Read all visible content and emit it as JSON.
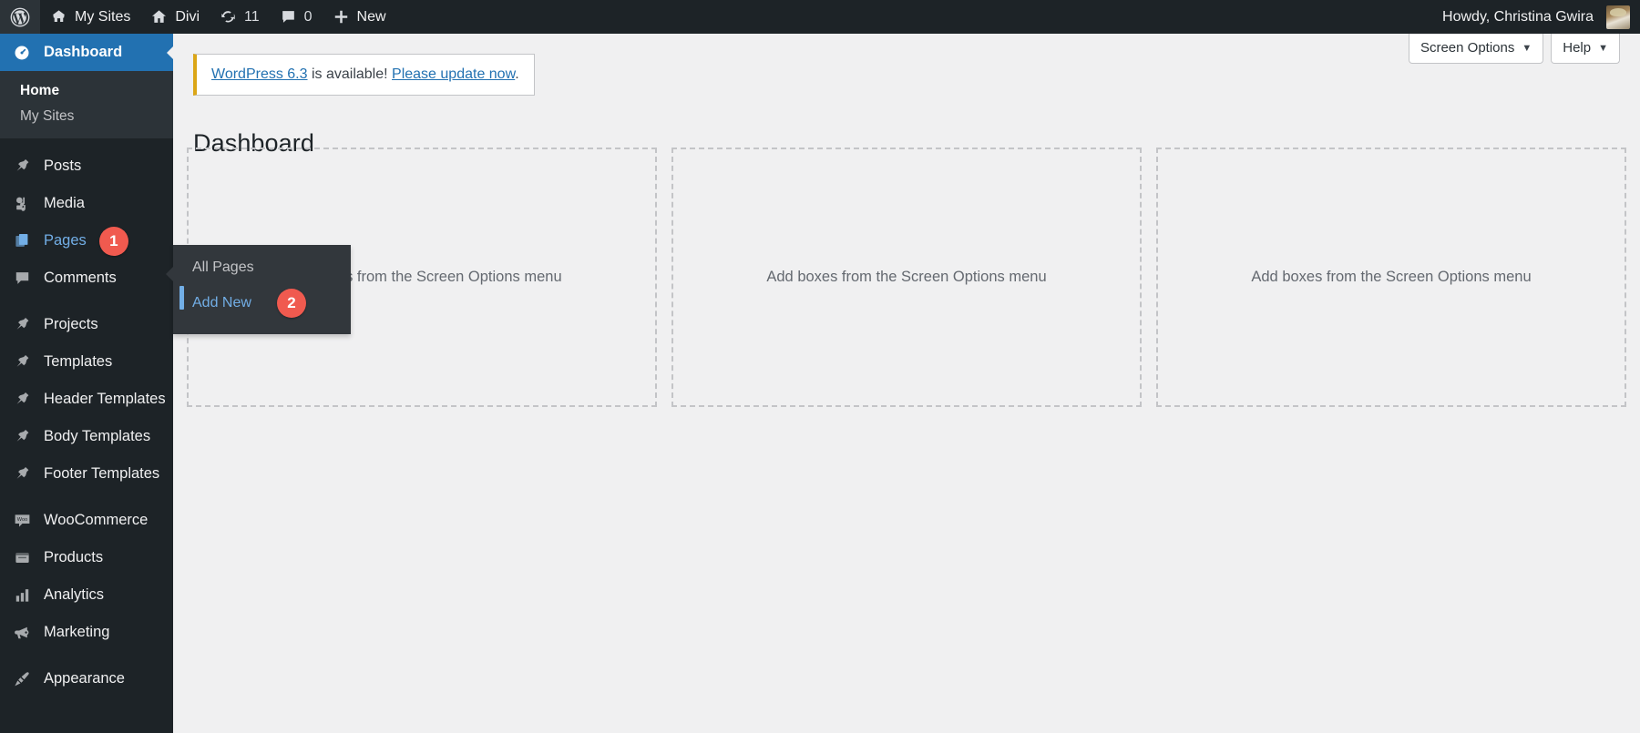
{
  "adminbar": {
    "logo_icon": "wordpress-logo-icon",
    "items": [
      {
        "label": "My Sites",
        "icon": "multisite-icon"
      },
      {
        "label": "Divi",
        "icon": "home-icon"
      },
      {
        "label": "11",
        "icon": "updates-icon"
      },
      {
        "label": "0",
        "icon": "comment-icon"
      },
      {
        "label": "New",
        "icon": "plus-icon"
      }
    ],
    "howdy": "Howdy, Christina Gwira",
    "avatar_icon": "user-avatar"
  },
  "sidebar": {
    "items": [
      {
        "label": "Dashboard",
        "icon": "dashboard-icon",
        "state": "current",
        "badge": null
      },
      {
        "label": "Posts",
        "icon": "pin-icon",
        "state": "normal",
        "badge": null
      },
      {
        "label": "Media",
        "icon": "media-icon",
        "state": "normal",
        "badge": null
      },
      {
        "label": "Pages",
        "icon": "pages-icon",
        "state": "hover",
        "badge": "1"
      },
      {
        "label": "Comments",
        "icon": "comment-icon",
        "state": "normal",
        "badge": null
      },
      {
        "label": "Projects",
        "icon": "pin-icon",
        "state": "normal",
        "badge": null
      },
      {
        "label": "Templates",
        "icon": "pin-icon",
        "state": "normal",
        "badge": null
      },
      {
        "label": "Header Templates",
        "icon": "pin-icon",
        "state": "normal",
        "badge": null
      },
      {
        "label": "Body Templates",
        "icon": "pin-icon",
        "state": "normal",
        "badge": null
      },
      {
        "label": "Footer Templates",
        "icon": "pin-icon",
        "state": "normal",
        "badge": null
      },
      {
        "label": "WooCommerce",
        "icon": "woocommerce-icon",
        "state": "normal",
        "badge": null
      },
      {
        "label": "Products",
        "icon": "products-icon",
        "state": "normal",
        "badge": null
      },
      {
        "label": "Analytics",
        "icon": "chart-bar-icon",
        "state": "normal",
        "badge": null
      },
      {
        "label": "Marketing",
        "icon": "megaphone-icon",
        "state": "normal",
        "badge": null
      },
      {
        "label": "Appearance",
        "icon": "paintbrush-icon",
        "state": "normal",
        "badge": null
      }
    ],
    "dashboard_submenu": [
      {
        "label": "Home",
        "state": "current"
      },
      {
        "label": "My Sites",
        "state": "normal"
      }
    ]
  },
  "flyout": {
    "items": [
      {
        "label": "All Pages",
        "state": "normal",
        "badge": null
      },
      {
        "label": "Add New",
        "state": "current",
        "badge": "2"
      }
    ]
  },
  "screen_meta": {
    "screen_options": "Screen Options",
    "help": "Help",
    "caret": "▼"
  },
  "notice": {
    "link_version": "WordPress 6.3",
    "middle": " is available! ",
    "link_update": "Please update now",
    "period": "."
  },
  "main": {
    "page_title": "Dashboard",
    "placeholder_text": "Add boxes from the Screen Options menu",
    "columns": [
      {
        "text": "Add boxes from the Screen Options menu"
      },
      {
        "text": "Add boxes from the Screen Options menu"
      },
      {
        "text": "Add boxes from the Screen Options menu"
      }
    ]
  },
  "colors": {
    "admin_dark": "#1d2327",
    "submenu_dark": "#2c3338",
    "flyout_dark": "#32373c",
    "accent_blue": "#2271b1",
    "link_blue": "#72aee6",
    "badge_red": "#f05a4f",
    "notice_yellow": "#dba617",
    "content_bg": "#f0f0f1"
  }
}
